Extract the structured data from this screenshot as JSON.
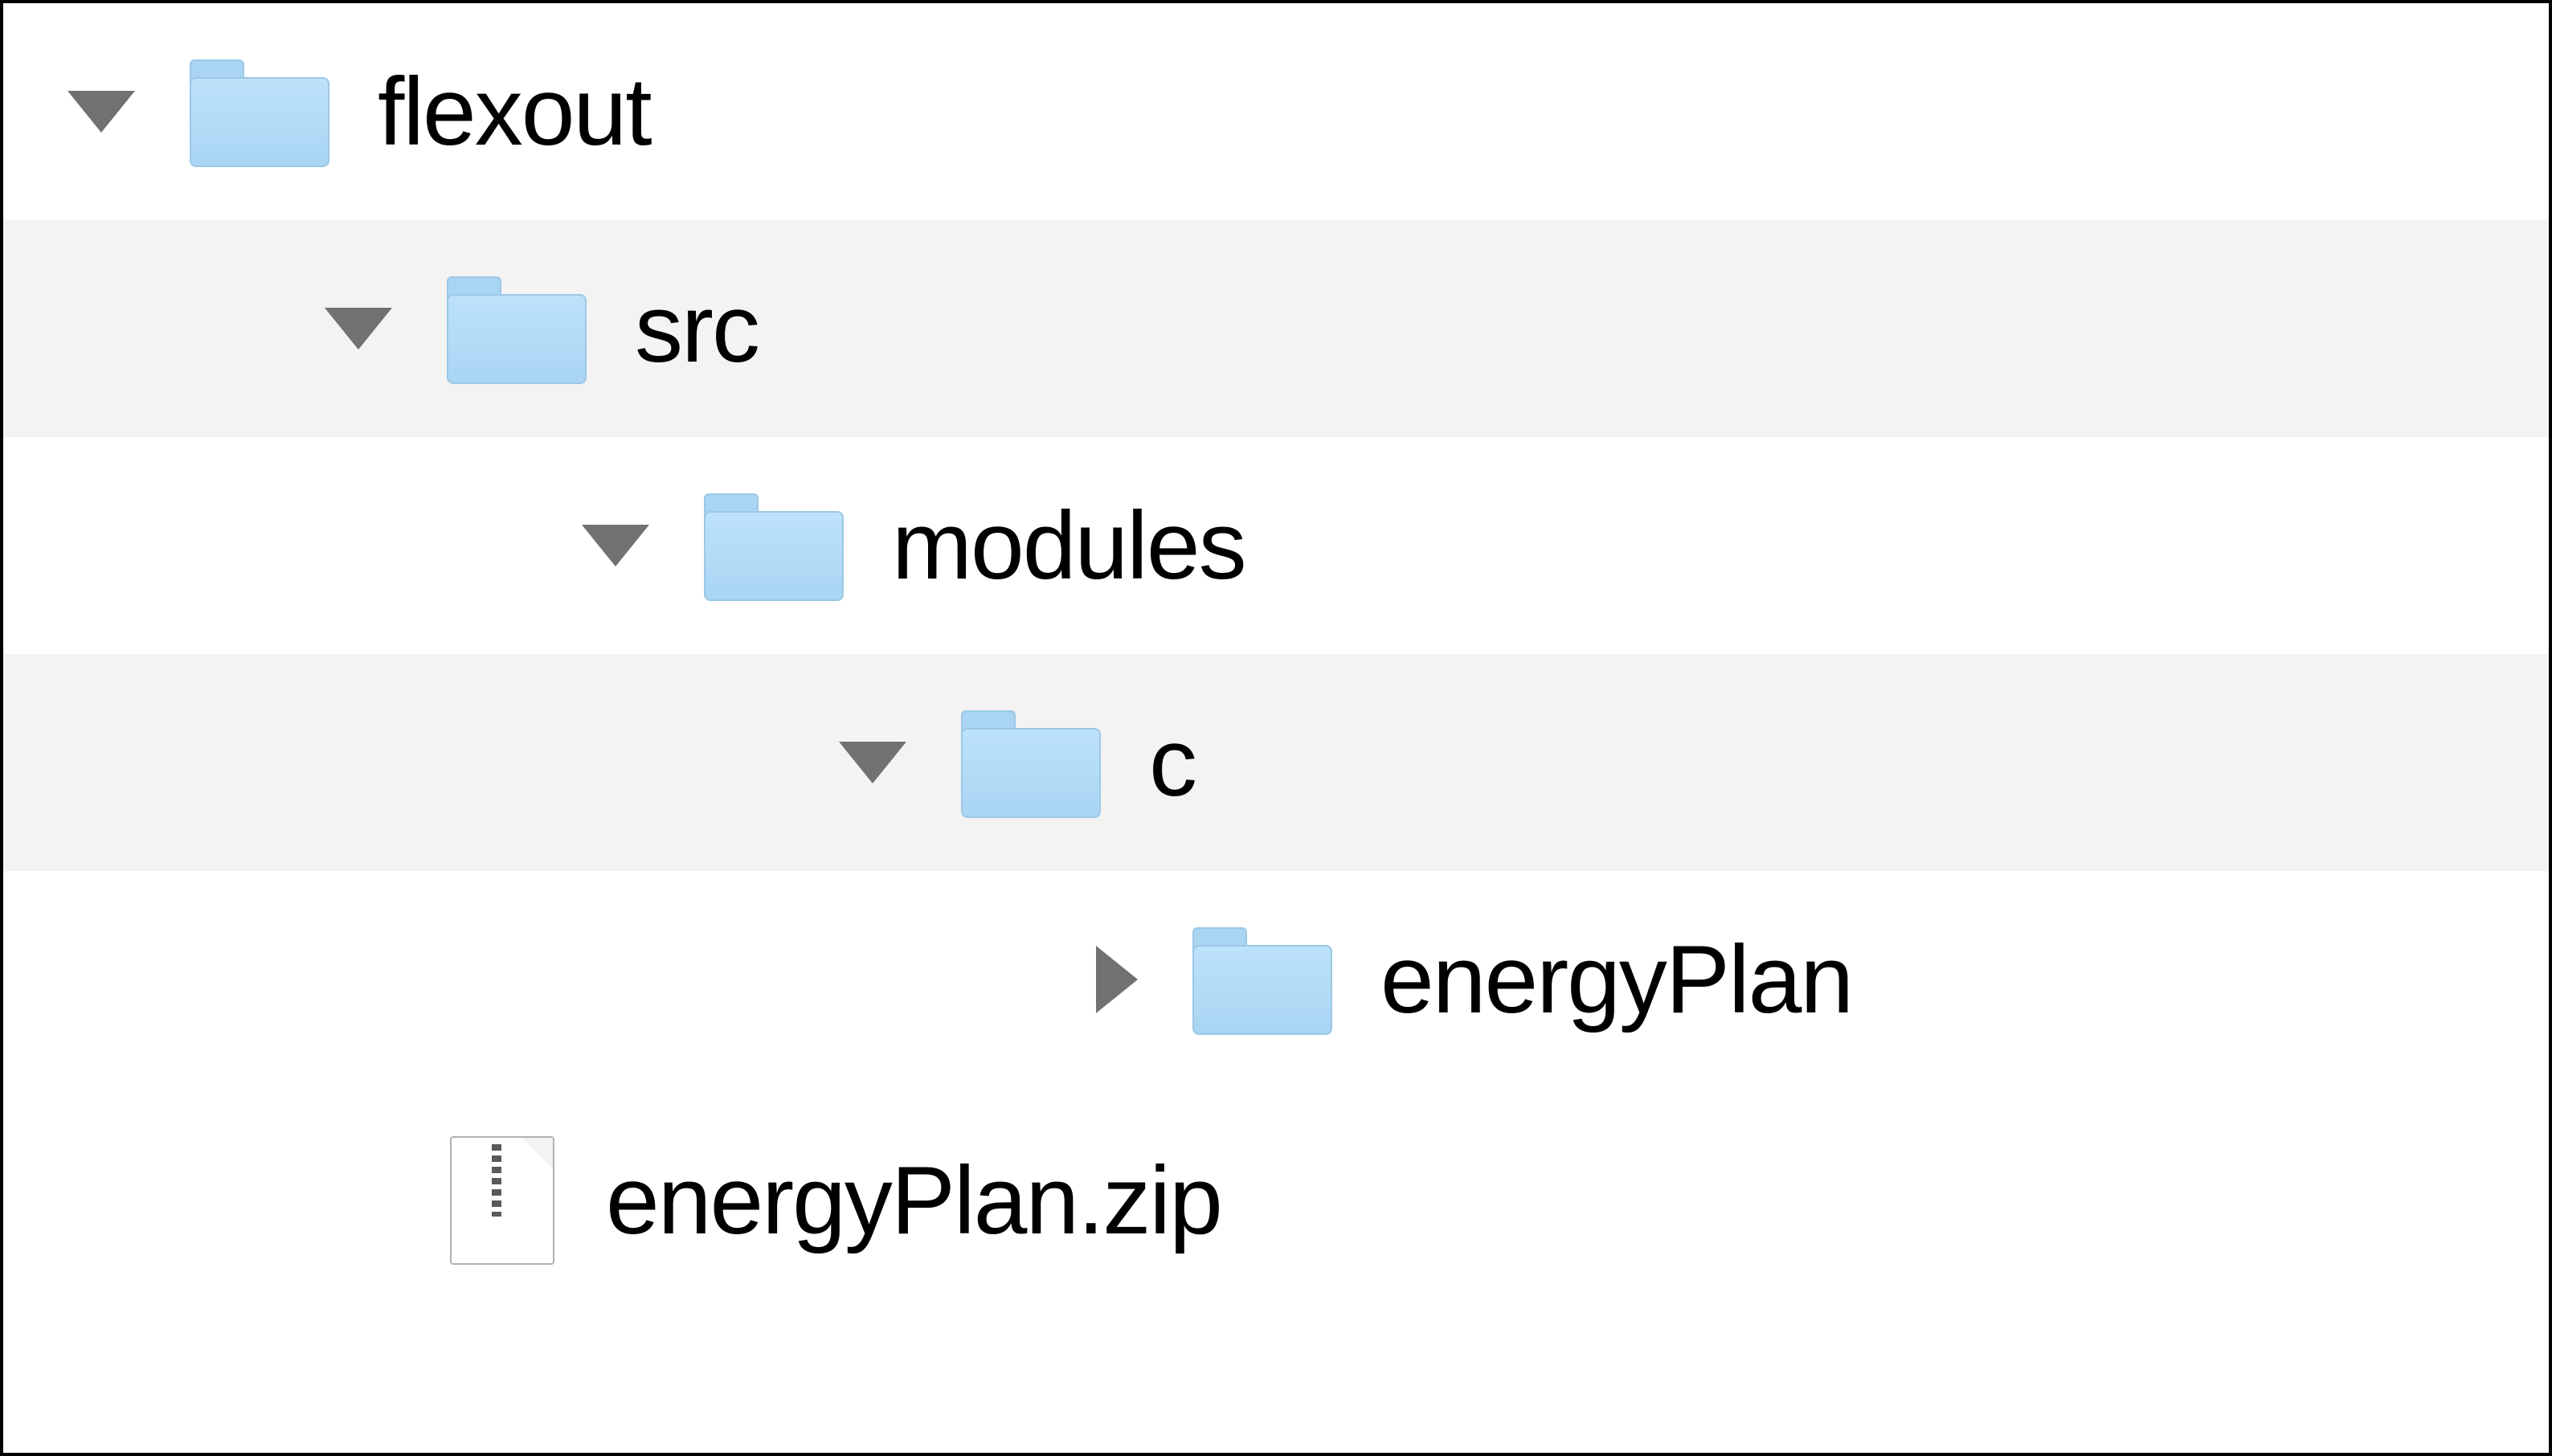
{
  "tree": {
    "items": [
      {
        "label": "flexout",
        "type": "folder",
        "expanded": true,
        "indent": 0
      },
      {
        "label": "src",
        "type": "folder",
        "expanded": true,
        "indent": 1
      },
      {
        "label": "modules",
        "type": "folder",
        "expanded": true,
        "indent": 2
      },
      {
        "label": "c",
        "type": "folder",
        "expanded": true,
        "indent": 3
      },
      {
        "label": "energyPlan",
        "type": "folder",
        "expanded": false,
        "indent": 4
      },
      {
        "label": "energyPlan.zip",
        "type": "zip",
        "expanded": null,
        "indent": 1
      }
    ]
  }
}
